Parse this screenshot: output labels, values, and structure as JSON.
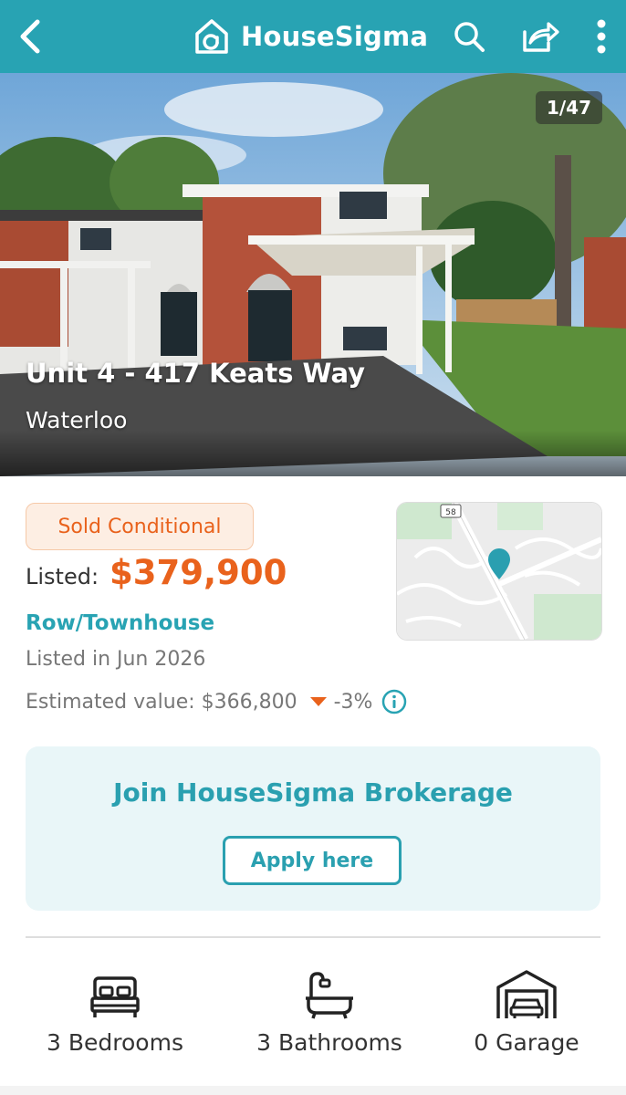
{
  "header": {
    "brand": "HouseSigma",
    "icons": [
      "back-chevron-icon",
      "house-logo-icon",
      "search-icon",
      "share-icon",
      "more-vertical-icon"
    ]
  },
  "hero": {
    "photo_counter": "1/47",
    "address": "Unit 4 - 417 Keats Way",
    "city": "Waterloo"
  },
  "listing": {
    "status": "Sold Conditional",
    "listed_label": "Listed:",
    "price": "$379,900",
    "property_type": "Row/Townhouse",
    "listed_date": "Listed in Jun 2026",
    "estimated_label": "Estimated value: $366,800",
    "estimated_change": "-3%",
    "map_route_label": "58"
  },
  "brokerage": {
    "title": "Join HouseSigma Brokerage",
    "button": "Apply here"
  },
  "features": [
    {
      "label": "3 Bedrooms",
      "icon": "bed-icon"
    },
    {
      "label": "3 Bathrooms",
      "icon": "bathtub-icon"
    },
    {
      "label": "0 Garage",
      "icon": "garage-icon"
    }
  ],
  "colors": {
    "brand": "#28a3b3",
    "accent_orange": "#e9621c",
    "card_bg": "#e9f6f8"
  }
}
